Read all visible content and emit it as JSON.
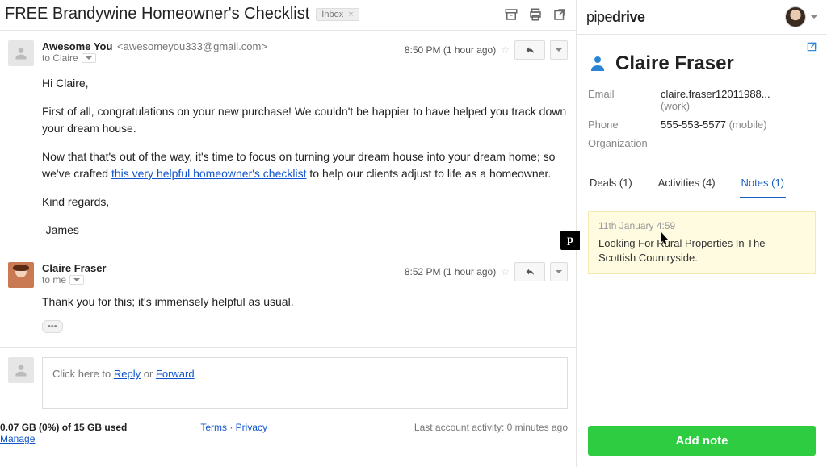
{
  "gmail": {
    "subject": "FREE Brandywine Homeowner's Checklist",
    "folder_chip": "Inbox",
    "messages": [
      {
        "sender_name": "Awesome You",
        "sender_addr": "<awesomeyou333@gmail.com>",
        "to_line": "to Claire",
        "time": "8:50 PM (1 hour ago)",
        "greeting": "Hi Claire,",
        "p1": "First of all, congratulations on your new purchase! We couldn't be happier to have helped you track down your dream house.",
        "p2a": "Now that that's out of the way, it's time to focus on turning your dream house into your dream home; so we've crafted ",
        "p2_link": "this very helpful homeowner's checklist",
        "p2b": " to help our clients adjust to life as a homeowner.",
        "p3": "Kind regards,",
        "p4": "-James"
      },
      {
        "sender_name": "Claire Fraser",
        "to_line": "to me",
        "time": "8:52 PM (1 hour ago)",
        "body": "Thank you for this; it's immensely helpful as usual."
      }
    ],
    "reply": {
      "prefix": "Click here to ",
      "reply_label": "Reply",
      "or": " or ",
      "forward_label": "Forward"
    },
    "footer": {
      "storage_bold": "0.07 GB (0%) of 15 GB used",
      "manage": "Manage",
      "terms": "Terms",
      "privacy": "Privacy",
      "activity": "Last account activity: 0 minutes ago"
    }
  },
  "pipedrive": {
    "logo_a": "pipe",
    "logo_b": "drive",
    "contact_name": "Claire Fraser",
    "fields": {
      "email_label": "Email",
      "email_value": "claire.fraser12011988...",
      "email_tag": "(work)",
      "phone_label": "Phone",
      "phone_value": "555-553-5577 ",
      "phone_tag": "(mobile)",
      "org_label": "Organization"
    },
    "tabs": {
      "deals": "Deals (1)",
      "activities": "Activities (4)",
      "notes": "Notes (1)"
    },
    "note": {
      "time": "11th January 4:59",
      "text": "Looking For Rural Properties In The Scottish Countryside."
    },
    "add_note": "Add note",
    "side_tab": "p"
  }
}
